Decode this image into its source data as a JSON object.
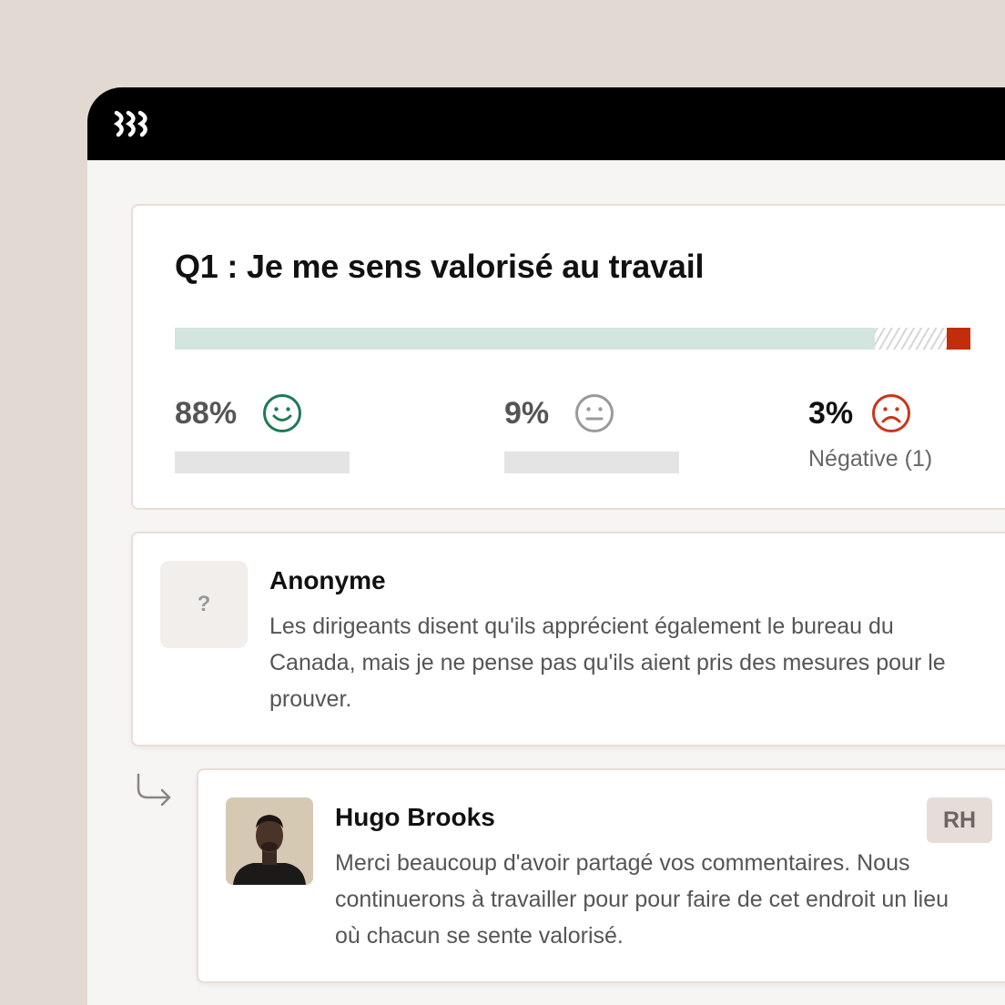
{
  "app": {
    "logo_icon": "brand-logo-icon"
  },
  "question": {
    "title": "Q1 : Je me sens valorisé au travail",
    "distribution": {
      "positive": 88,
      "neutral": 9,
      "negative": 3
    },
    "stats": [
      {
        "value": "88%",
        "icon": "smile-icon",
        "color": "#1f7a55"
      },
      {
        "value": "9%",
        "icon": "neutral-face-icon",
        "color": "#9a9a9a"
      },
      {
        "value": "3%",
        "icon": "frown-icon",
        "color": "#c9361a",
        "label": "Négative (1)"
      }
    ]
  },
  "comment": {
    "avatar_glyph": "?",
    "author": "Anonyme",
    "text": "Les dirigeants disent qu'ils apprécient également le bureau du Canada, mais je ne pense pas qu'ils aient pris des mesures pour le prouver."
  },
  "reply": {
    "icon": "reply-arrow-icon",
    "author": "Hugo Brooks",
    "badge": "RH",
    "text": "Merci beaucoup d'avoir partagé vos commentaires. Nous continuerons à travailler pour pour faire de cet endroit un lieu où chacun se sente valorisé."
  }
}
